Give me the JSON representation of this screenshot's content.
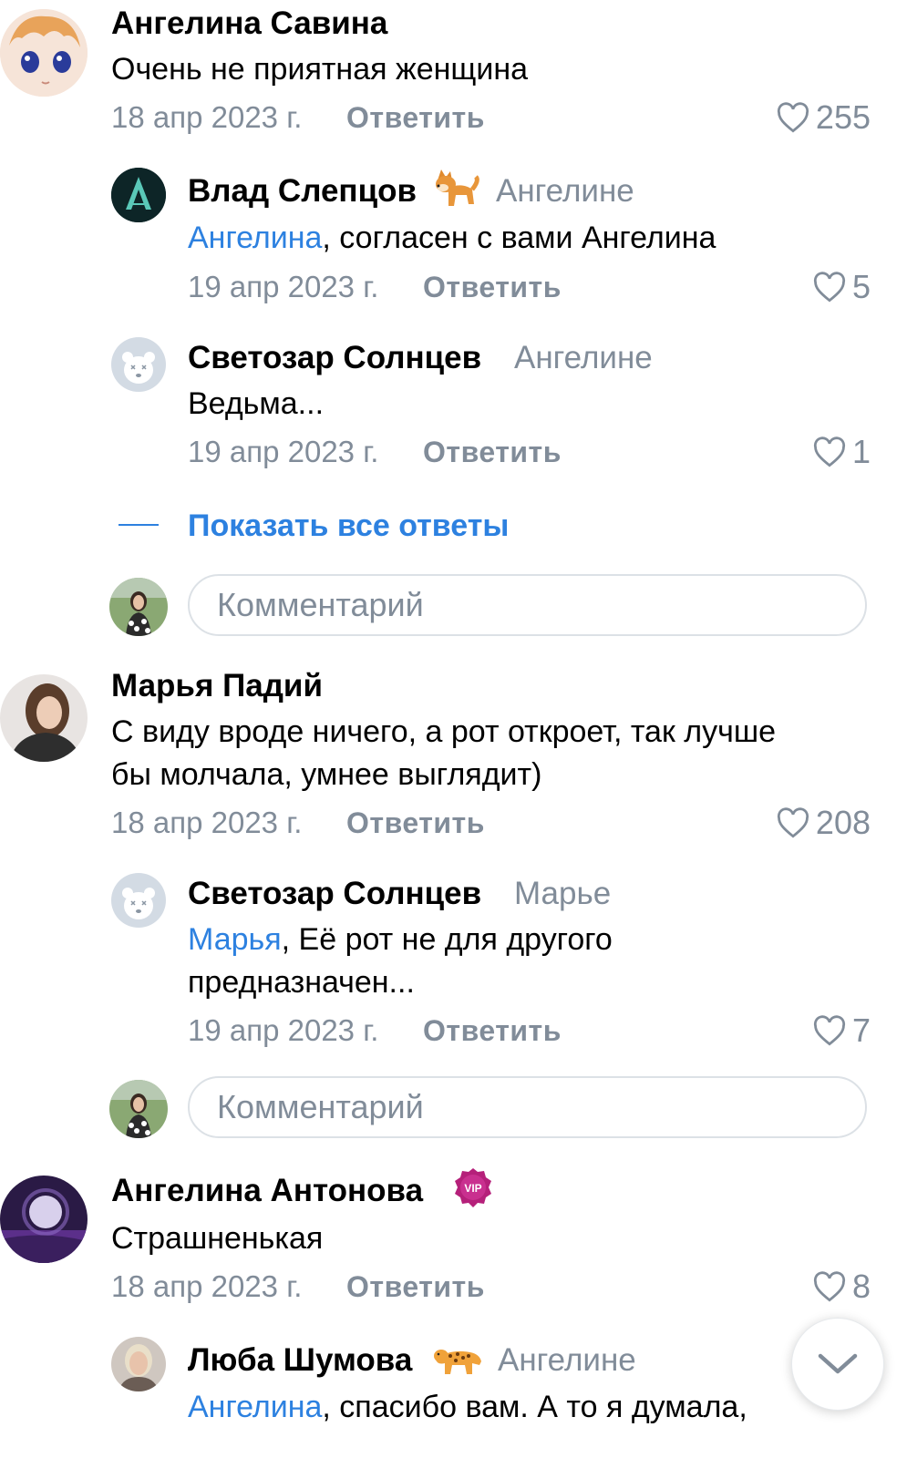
{
  "comments": [
    {
      "author": "Ангелина Савина",
      "text": "Очень не приятная женщина",
      "date": "18 апр 2023 г.",
      "reply_label": "Ответить",
      "likes": "255",
      "replies": [
        {
          "author": "Влад Слепцов",
          "to": "Ангелине",
          "mention": "Ангелина",
          "text": ", согласен с вами Ангелина",
          "date": "19 апр 2023 г.",
          "reply_label": "Ответить",
          "likes": "5"
        },
        {
          "author": "Светозар Солнцев",
          "to": "Ангелине",
          "text": "Ведьма...",
          "date": "19 апр 2023 г.",
          "reply_label": "Ответить",
          "likes": "1"
        }
      ],
      "show_all_label": "Показать все ответы",
      "comment_placeholder": "Комментарий"
    },
    {
      "author": "Марья Падий",
      "text_line1": "С виду вроде ничего, а рот откроет, так лучше",
      "text_line2": "бы молчала, умнее выглядит)",
      "date": "18 апр 2023 г.",
      "reply_label": "Ответить",
      "likes": "208",
      "replies": [
        {
          "author": "Светозар Солнцев",
          "to": "Марье",
          "mention": "Марья",
          "text_line1": ", Её рот не для другого",
          "text_line2": "предназначен...",
          "date": "19 апр 2023 г.",
          "reply_label": "Ответить",
          "likes": "7"
        }
      ],
      "comment_placeholder": "Комментарий"
    },
    {
      "author": "Ангелина Антонова",
      "badge": "VIP",
      "text": "Страшненькая",
      "date": "18 апр 2023 г.",
      "reply_label": "Ответить",
      "likes": "8",
      "replies": [
        {
          "author": "Люба Шумова",
          "to": "Ангелине",
          "mention": "Ангелина",
          "text": ", спасибо вам. А то я думала,"
        }
      ]
    }
  ],
  "icons": {
    "like": "heart-outline-icon",
    "scroll_down": "chevron-down-icon",
    "emoji_dog": "shiba-dog-emoji",
    "emoji_leopard": "leopard-emoji"
  },
  "colors": {
    "accent": "#2d81e0",
    "secondary_text": "#818c99",
    "input_border": "#dce1e6",
    "vip_badge": "#b5207a"
  }
}
